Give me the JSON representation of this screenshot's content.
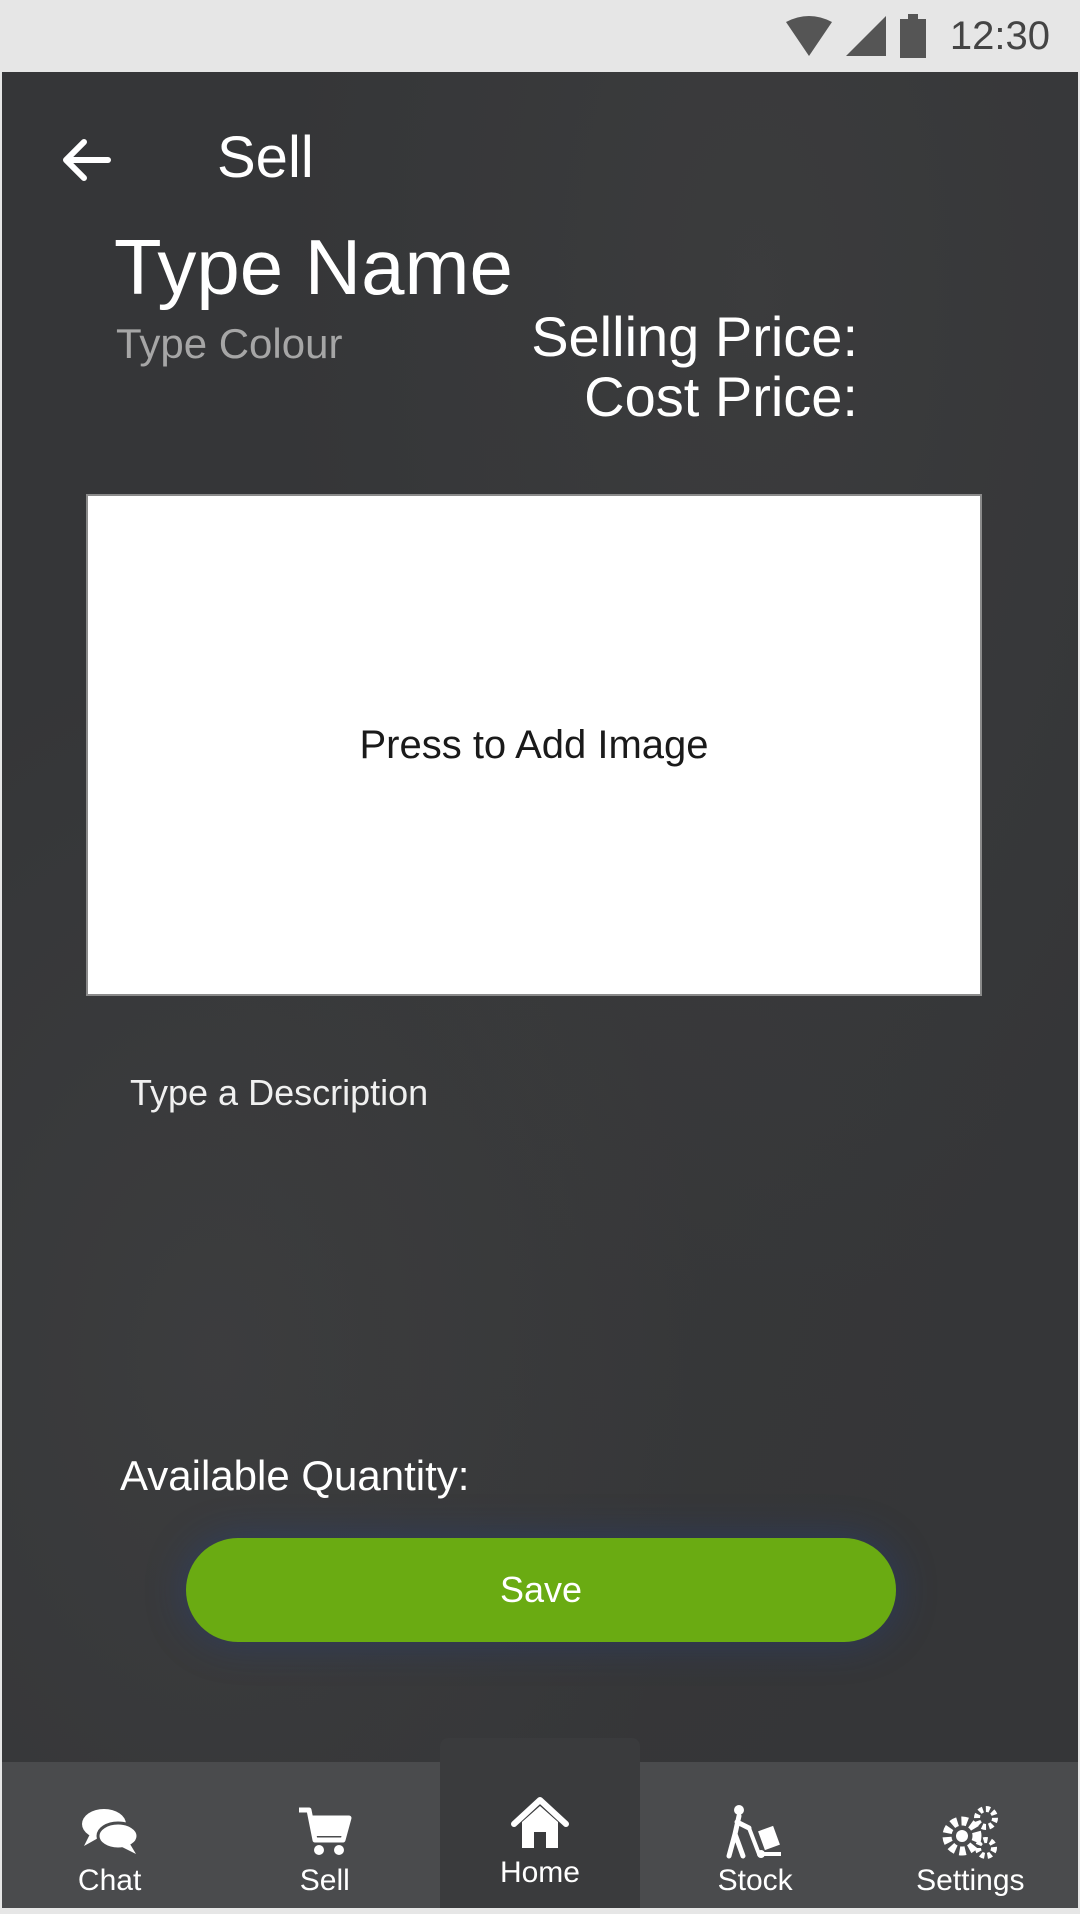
{
  "statusbar": {
    "time": "12:30"
  },
  "header": {
    "title": "Sell"
  },
  "item": {
    "name": "Type Name",
    "colour": "Type Colour",
    "selling_price_label": "Selling Price:",
    "cost_price_label": "Cost Price:",
    "image_prompt": "Press to Add Image",
    "description_placeholder": "Type a Description",
    "quantity_label": "Available Quantity:"
  },
  "actions": {
    "save_label": "Save"
  },
  "colors": {
    "accent": "#6aab12",
    "background": "#353638",
    "nav": "#4a4b4d"
  },
  "nav": {
    "items": [
      {
        "label": "Chat",
        "icon": "chat-icon"
      },
      {
        "label": "Sell",
        "icon": "cart-icon"
      },
      {
        "label": "Home",
        "icon": "home-icon",
        "active": true
      },
      {
        "label": "Stock",
        "icon": "hand-truck-icon"
      },
      {
        "label": "Settings",
        "icon": "gears-icon"
      }
    ]
  }
}
